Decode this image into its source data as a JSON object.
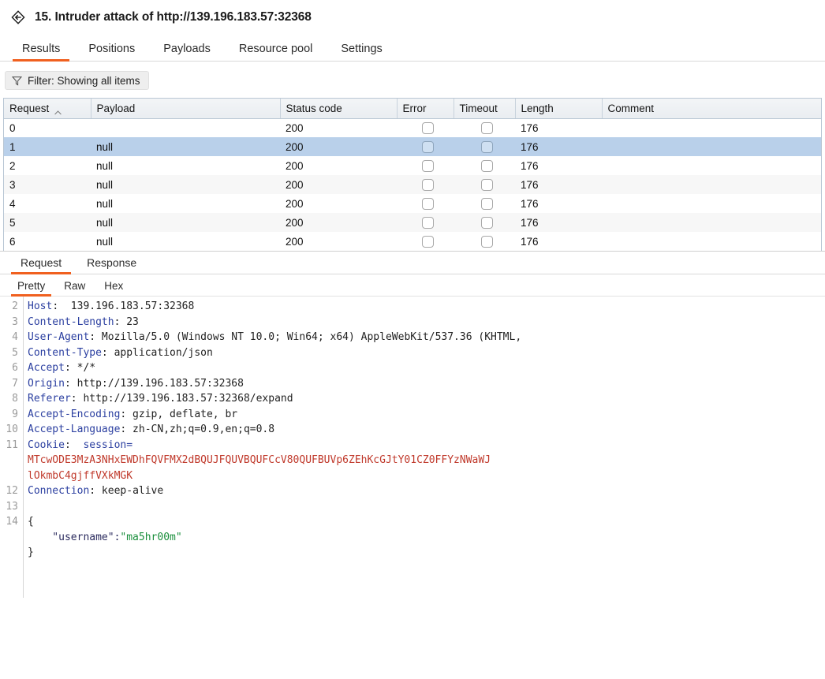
{
  "window": {
    "detach_icon": "collapse-diamond-icon",
    "title": "15. Intruder attack of http://139.196.183.57:32368"
  },
  "main_tabs": [
    {
      "label": "Results",
      "active": true
    },
    {
      "label": "Positions",
      "active": false
    },
    {
      "label": "Payloads",
      "active": false
    },
    {
      "label": "Resource pool",
      "active": false
    },
    {
      "label": "Settings",
      "active": false
    }
  ],
  "filter": {
    "icon": "funnel-icon",
    "label": "Filter: Showing all items"
  },
  "results_table": {
    "columns": [
      "Request",
      "Payload",
      "Status code",
      "Error",
      "Timeout",
      "Length",
      "Comment"
    ],
    "sorted_column": "Request",
    "sort_direction": "ascending",
    "rows": [
      {
        "request": "0",
        "payload": "",
        "status": "200",
        "error": false,
        "timeout": false,
        "length": "176",
        "comment": "",
        "selected": false
      },
      {
        "request": "1",
        "payload": "null",
        "status": "200",
        "error": false,
        "timeout": false,
        "length": "176",
        "comment": "",
        "selected": true
      },
      {
        "request": "2",
        "payload": "null",
        "status": "200",
        "error": false,
        "timeout": false,
        "length": "176",
        "comment": "",
        "selected": false
      },
      {
        "request": "3",
        "payload": "null",
        "status": "200",
        "error": false,
        "timeout": false,
        "length": "176",
        "comment": "",
        "selected": false
      },
      {
        "request": "4",
        "payload": "null",
        "status": "200",
        "error": false,
        "timeout": false,
        "length": "176",
        "comment": "",
        "selected": false
      },
      {
        "request": "5",
        "payload": "null",
        "status": "200",
        "error": false,
        "timeout": false,
        "length": "176",
        "comment": "",
        "selected": false
      },
      {
        "request": "6",
        "payload": "null",
        "status": "200",
        "error": false,
        "timeout": false,
        "length": "176",
        "comment": "",
        "selected": false
      }
    ]
  },
  "message_tabs": [
    {
      "label": "Request",
      "active": true
    },
    {
      "label": "Response",
      "active": false
    }
  ],
  "view_tabs": [
    {
      "label": "Pretty",
      "active": true
    },
    {
      "label": "Raw",
      "active": false
    },
    {
      "label": "Hex",
      "active": false
    }
  ],
  "request_lines": [
    {
      "no": "2",
      "segments": [
        {
          "text": "Host",
          "style": "hdr-name"
        },
        {
          "text": ":  139.196.183.57:32368",
          "style": "hdr-val"
        }
      ]
    },
    {
      "no": "3",
      "segments": [
        {
          "text": "Content-Length",
          "style": "hdr-name"
        },
        {
          "text": ": 23",
          "style": "hdr-val"
        }
      ]
    },
    {
      "no": "4",
      "segments": [
        {
          "text": "User-Agent",
          "style": "hdr-name"
        },
        {
          "text": ": Mozilla/5.0 (Windows NT 10.0; Win64; x64) AppleWebKit/537.36 (KHTML,",
          "style": "hdr-val"
        }
      ]
    },
    {
      "no": "5",
      "segments": [
        {
          "text": "Content-Type",
          "style": "hdr-name"
        },
        {
          "text": ": application/json",
          "style": "hdr-val"
        }
      ]
    },
    {
      "no": "6",
      "segments": [
        {
          "text": "Accept",
          "style": "hdr-name"
        },
        {
          "text": ": */*",
          "style": "hdr-val"
        }
      ]
    },
    {
      "no": "7",
      "segments": [
        {
          "text": "Origin",
          "style": "hdr-name"
        },
        {
          "text": ": http://139.196.183.57:32368",
          "style": "hdr-val"
        }
      ]
    },
    {
      "no": "8",
      "segments": [
        {
          "text": "Referer",
          "style": "hdr-name"
        },
        {
          "text": ": http://139.196.183.57:32368/expand",
          "style": "hdr-val"
        }
      ]
    },
    {
      "no": "9",
      "segments": [
        {
          "text": "Accept-Encoding",
          "style": "hdr-name"
        },
        {
          "text": ": gzip, deflate, br",
          "style": "hdr-val"
        }
      ]
    },
    {
      "no": "10",
      "segments": [
        {
          "text": "Accept-Language",
          "style": "hdr-name"
        },
        {
          "text": ": zh-CN,zh;q=0.9,en;q=0.8",
          "style": "hdr-val"
        }
      ]
    },
    {
      "no": "11",
      "segments": [
        {
          "text": "Cookie",
          "style": "hdr-name"
        },
        {
          "text": ":  ",
          "style": "hdr-val"
        },
        {
          "text": "session=",
          "style": "hdr-name"
        }
      ]
    },
    {
      "no": "",
      "segments": [
        {
          "text": "MTcwODE3MzA3NHxEWDhFQVFMX2dBQUJFQUVBQUFCcV80QUFBUVp6ZEhKcGJtY01CZ0FFYzNWaWJ",
          "style": "cookie-val"
        }
      ]
    },
    {
      "no": "",
      "segments": [
        {
          "text": "lOkmbC4gjffVXkMGK",
          "style": "cookie-val"
        }
      ]
    },
    {
      "no": "12",
      "segments": [
        {
          "text": "Connection",
          "style": "hdr-name"
        },
        {
          "text": ": keep-alive",
          "style": "hdr-val"
        }
      ]
    },
    {
      "no": "13",
      "segments": [
        {
          "text": "",
          "style": "hdr-val"
        }
      ]
    },
    {
      "no": "14",
      "segments": [
        {
          "text": "{",
          "style": "json-punc"
        }
      ]
    },
    {
      "no": "",
      "segments": [
        {
          "text": "    \"username\":",
          "style": "json-key"
        },
        {
          "text": "\"ma5hr00m\"",
          "style": "json-str"
        }
      ]
    },
    {
      "no": "",
      "segments": [
        {
          "text": "}",
          "style": "json-punc"
        }
      ]
    }
  ],
  "colors": {
    "accent": "#f0601f",
    "selection": "#b9d0ea",
    "header_name": "#2b3fa0",
    "cookie_value": "#c0392b",
    "json_string": "#1a8f3c"
  }
}
